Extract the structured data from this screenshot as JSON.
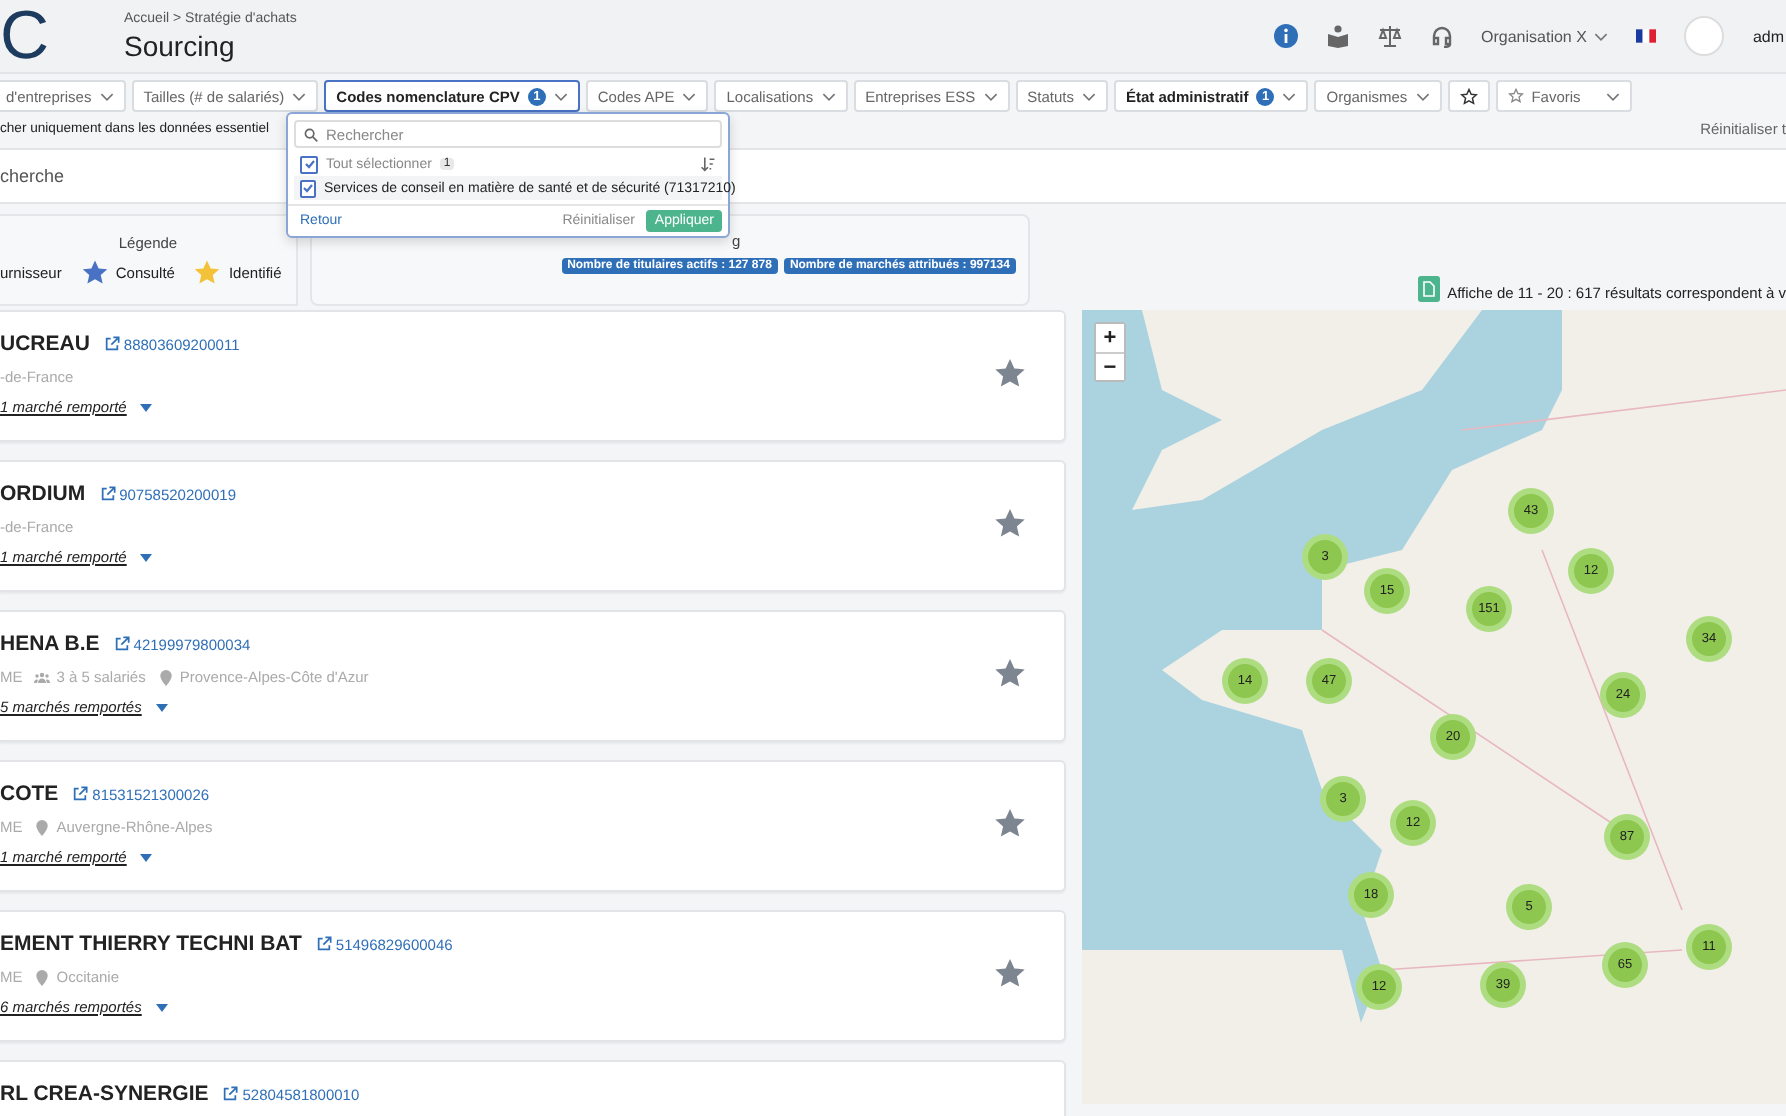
{
  "header": {
    "logo": "C",
    "breadcrumb": "Accueil > Stratégie d'achats",
    "title": "Sourcing",
    "organisation": "Organisation X",
    "user": "adm"
  },
  "filters": [
    {
      "kind": "select",
      "label": "d'entreprises",
      "open": false
    },
    {
      "kind": "select",
      "label": "Tailles (# de salariés)",
      "open": false
    },
    {
      "kind": "select",
      "label": "Codes nomenclature CPV",
      "count": "1",
      "open": true
    },
    {
      "kind": "select",
      "label": "Codes APE",
      "open": false
    },
    {
      "kind": "select",
      "label": "Localisations",
      "open": false
    },
    {
      "kind": "select",
      "label": "Entreprises ESS",
      "open": false
    },
    {
      "kind": "select",
      "label": "Statuts",
      "open": false
    },
    {
      "kind": "select",
      "label": "État administratif",
      "count": "1",
      "open": false
    },
    {
      "kind": "select",
      "label": "Organismes",
      "open": false
    },
    {
      "kind": "star",
      "open": false
    },
    {
      "kind": "favorites",
      "label": "Favoris",
      "open": false
    }
  ],
  "essential_toggle": "cher uniquement dans les données essentiel",
  "reset_all": "Réinitialiser t",
  "search": {
    "placeholder": "cherche"
  },
  "dropdown": {
    "search_placeholder": "Rechercher",
    "select_all": {
      "label": "Tout sélectionner",
      "count": "1",
      "checked": true
    },
    "options": [
      {
        "label": "Services de conseil en matière de santé et de sécurité (71317210)",
        "checked": true
      }
    ],
    "back": "Retour",
    "reset": "Réinitialiser",
    "apply": "Appliquer"
  },
  "legend": {
    "title": "Légende",
    "items": [
      {
        "label": "urnisseur"
      },
      {
        "label": "Consulté",
        "color": "#4a72c4"
      },
      {
        "label": "Identifié",
        "color": "#f3c238"
      }
    ]
  },
  "stats": {
    "heading": "g",
    "badges": [
      "Nombre de titulaires actifs : 127 878",
      "Nombre de marchés attribués : 997134"
    ]
  },
  "results_text": "Affiche de 11 - 20 : 617 résultats correspondent à v",
  "companies": [
    {
      "name": "UCREAU",
      "siret": "88803609200011",
      "meta": [
        {
          "kind": "text",
          "label": "-de-France"
        }
      ],
      "markets": "1 marché remporté"
    },
    {
      "name": "ORDIUM",
      "siret": "90758520200019",
      "meta": [
        {
          "kind": "text",
          "label": "-de-France"
        }
      ],
      "markets": "1 marché remporté"
    },
    {
      "name": "HENA B.E",
      "siret": "42199979800034",
      "meta": [
        {
          "kind": "text",
          "label": "ME"
        },
        {
          "kind": "size",
          "label": "3 à 5 salariés"
        },
        {
          "kind": "region",
          "label": "Provence-Alpes-Côte d'Azur"
        }
      ],
      "markets": "5 marchés remportés"
    },
    {
      "name": "COTE",
      "siret": "81531521300026",
      "meta": [
        {
          "kind": "text",
          "label": "ME"
        },
        {
          "kind": "region",
          "label": "Auvergne-Rhône-Alpes"
        }
      ],
      "markets": "1 marché remporté"
    },
    {
      "name": "EMENT THIERRY TECHNI BAT",
      "siret": "51496829600046",
      "meta": [
        {
          "kind": "text",
          "label": "ME"
        },
        {
          "kind": "region",
          "label": "Occitanie"
        }
      ],
      "markets": "6 marchés remportés"
    },
    {
      "name": "RL CREA-SYNERGIE",
      "siret": "52804581800010"
    }
  ],
  "map": {
    "zoom_in": "+",
    "zoom_out": "−",
    "clusters": [
      "43",
      "3",
      "15",
      "151",
      "12",
      "34",
      "14",
      "47",
      "24",
      "20",
      "3",
      "12",
      "87",
      "18",
      "5",
      "11",
      "65",
      "12",
      "39"
    ]
  }
}
